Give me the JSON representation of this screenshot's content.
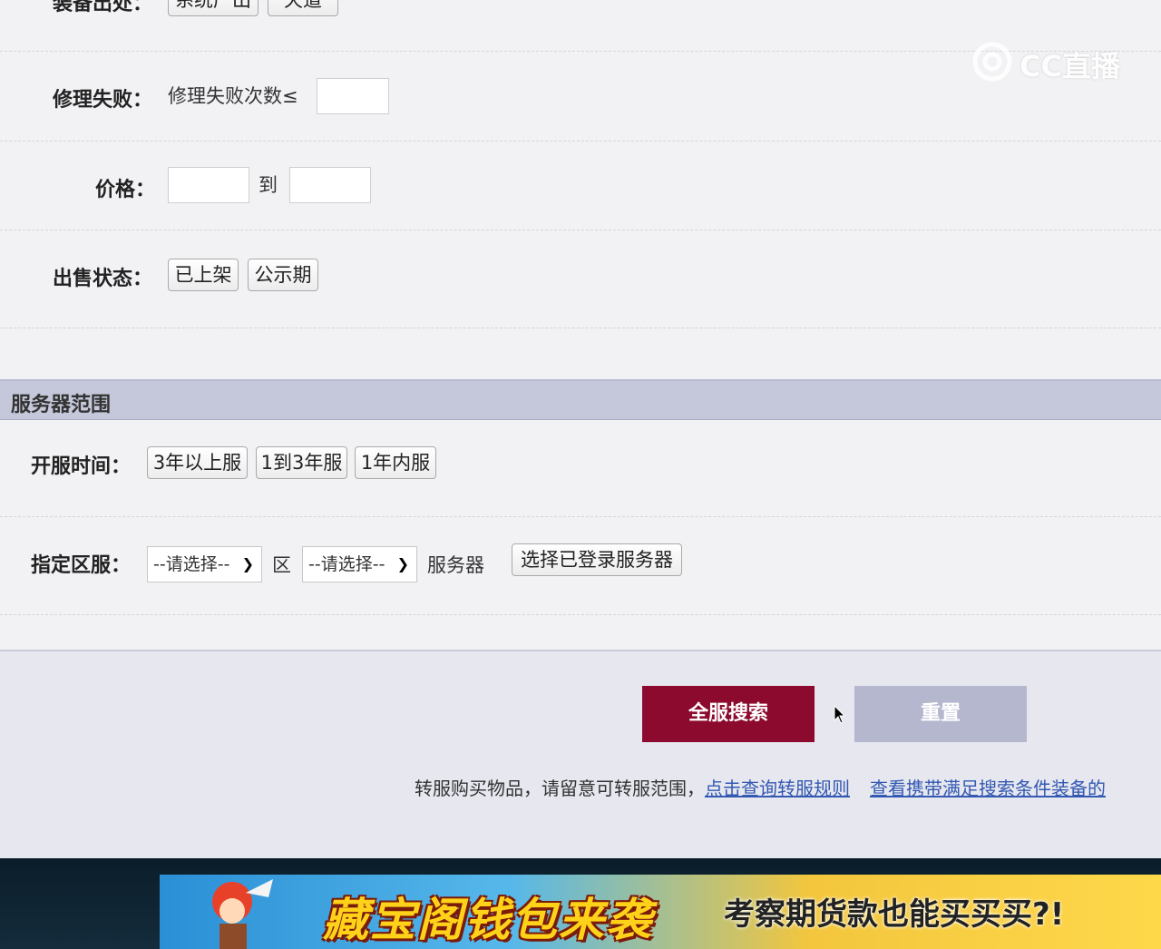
{
  "watermark": {
    "text": "CC直播",
    "icon": "cc-logo-icon"
  },
  "filters": {
    "equip_source": {
      "label": "装备出处：",
      "options": [
        "系统产出",
        "天道"
      ]
    },
    "repair_fail": {
      "label": "修理失败：",
      "prefix": "修理失败次数≤",
      "value": ""
    },
    "price": {
      "label": "价格：",
      "min": "",
      "to": "到",
      "max": ""
    },
    "sale_status": {
      "label": "出售状态：",
      "options": [
        "已上架",
        "公示期"
      ]
    }
  },
  "server_range": {
    "title": "服务器范围",
    "open_time": {
      "label": "开服时间：",
      "options": [
        "3年以上服",
        "1到3年服",
        "1年内服"
      ]
    },
    "zone": {
      "label": "指定区服：",
      "zone_select": "--请选择--",
      "zone_suffix": "区",
      "server_select": "--请选择--",
      "server_suffix": "服务器",
      "pick_button": "选择已登录服务器"
    }
  },
  "actions": {
    "search": "全服搜索",
    "reset": "重置"
  },
  "notice": {
    "text": "转服购买物品，请留意可转服范围，",
    "link1": "点击查询转服规则",
    "link2": "查看携带满足搜索条件装备的"
  },
  "banner": {
    "title": "藏宝阁钱包来袭",
    "subtitle": "考察期货款也能买买买?!"
  },
  "colors": {
    "search_button": "#8c0a2e",
    "reset_button": "#b4b7cd",
    "section_bar": "#c5c8db",
    "link": "#3359b3"
  }
}
